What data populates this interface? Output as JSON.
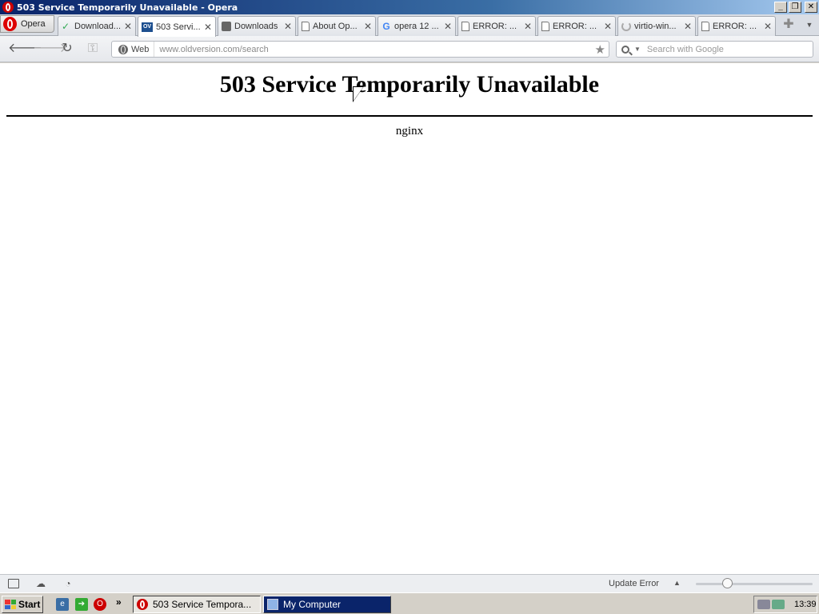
{
  "window": {
    "title": "503 Service Temporarily Unavailable - Opera"
  },
  "opera_menu": {
    "label": "Opera"
  },
  "tabs": [
    {
      "label": "Download...",
      "icon": "v-check-icon",
      "active": false
    },
    {
      "label": "503 Servi...",
      "icon": "oldversion-icon",
      "active": true
    },
    {
      "label": "Downloads",
      "icon": "download-icon",
      "active": false
    },
    {
      "label": "About Op...",
      "icon": "page-icon",
      "active": false
    },
    {
      "label": "opera 12 ...",
      "icon": "google-icon",
      "active": false
    },
    {
      "label": "ERROR: ...",
      "icon": "page-icon",
      "active": false
    },
    {
      "label": "ERROR: ...",
      "icon": "page-icon",
      "active": false
    },
    {
      "label": "virtio-win...",
      "icon": "loading-icon",
      "active": false
    },
    {
      "label": "ERROR: ...",
      "icon": "page-icon",
      "active": false
    }
  ],
  "address": {
    "badge": "Web",
    "url": "www.oldversion.com/search"
  },
  "search": {
    "placeholder": "Search with Google"
  },
  "page": {
    "heading": "503 Service Temporarily Unavailable",
    "server": "nginx"
  },
  "status": {
    "update_text": "Update Error",
    "zoom_fraction": 0.27
  },
  "taskbar": {
    "start_label": "Start",
    "items": [
      {
        "label": "503 Service Tempora...",
        "active": false
      },
      {
        "label": "My Computer",
        "active": true
      }
    ],
    "clock": "13:39"
  }
}
